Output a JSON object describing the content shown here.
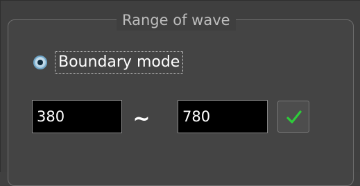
{
  "group": {
    "title": "Range of wave"
  },
  "mode": {
    "label": "Boundary mode",
    "selected": true
  },
  "range": {
    "min_value": "380",
    "separator": "~",
    "max_value": "780"
  },
  "apply_button": {
    "icon": "checkmark-icon",
    "icon_color": "#2ecc3a"
  },
  "colors": {
    "panel_background": "#404040",
    "field_background": "#000000",
    "title_text": "#bdbdbd",
    "label_text": "#ffffff"
  }
}
